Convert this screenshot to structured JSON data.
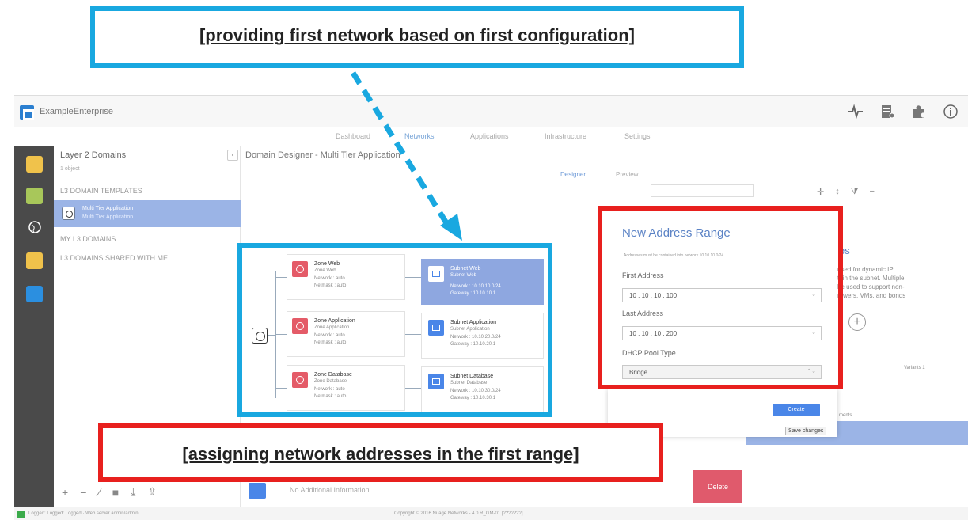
{
  "annotations": {
    "top_callout": "[providing first network based on first configuration]",
    "bottom_callout": "[assigning network addresses in the first range]"
  },
  "app": {
    "title": "ExampleEnterprise",
    "nav_tabs": [
      "Dashboard",
      "Networks",
      "Applications",
      "Infrastructure",
      "Settings"
    ],
    "active_tab": "Networks"
  },
  "panel": {
    "heading": "Layer 2 Domains",
    "object_count": "1 object",
    "categories": [
      "L3 DOMAIN TEMPLATES",
      "MY L3 DOMAINS",
      "L3 DOMAINS SHARED WITH ME"
    ],
    "selected_item": {
      "line1": "Multi Tier Application",
      "line2": "Multi Tier Application"
    }
  },
  "designer": {
    "heading": "Domain Designer - Multi Tier Application",
    "designer_link": "Designer",
    "preview_label": "Preview"
  },
  "diagram": {
    "zones": [
      {
        "name": "Zone Web",
        "sub": "Zone Web",
        "network": "Network : auto",
        "netmask": "Netmask : auto"
      },
      {
        "name": "Zone Application",
        "sub": "Zone Application",
        "network": "Network : auto",
        "netmask": "Netmask : auto"
      },
      {
        "name": "Zone Database",
        "sub": "Zone Database",
        "network": "Network : auto",
        "netmask": "Netmask : auto"
      }
    ],
    "subnets": [
      {
        "name": "Subnet Web",
        "sub": "Subnet Web",
        "network": "Network : 10.10.10.0/24",
        "gateway": "Gateway : 10.10.10.1"
      },
      {
        "name": "Subnet Application",
        "sub": "Subnet Application",
        "network": "Network : 10.10.20.0/24",
        "gateway": "Gateway : 10.10.20.1"
      },
      {
        "name": "Subnet Database",
        "sub": "Subnet Database",
        "network": "Network : 10.10.30.0/24",
        "gateway": "Gateway : 10.10.30.1"
      }
    ]
  },
  "dialog": {
    "title": "New Address Range",
    "note": "Addresses must be contained into network 10.10.10.0/24",
    "first_address_label": "First Address",
    "first_address_value": "10  .  10  .  10  .  100",
    "last_address_label": "Last Address",
    "last_address_value": "10  .  10  .  10  .  200",
    "pool_type_label": "DHCP Pool Type",
    "pool_type_value": "Bridge",
    "create_label": "Create",
    "tooltip": "Save changes"
  },
  "right_panel": {
    "heading": "es",
    "text_lines": [
      "used for dynamic IP",
      "thin the subnet. Multiple",
      "be used to support non-",
      "rewers, VMs, and bonds"
    ],
    "variants": "Variants 1",
    "strip_text": "ments"
  },
  "bottom": {
    "info_text": "No Additional Information",
    "delete_label": "Delete"
  },
  "statusbar": {
    "left": "Logged: Logged: Logged  ·  Web server admin/admin",
    "mid": "Copyright © 2016 Nuage Networks - 4.0.R_GM-01 [???????]"
  },
  "colors": {
    "callout_blue": "#19a8e0",
    "callout_red": "#e8201e",
    "accent": "#4a86e8",
    "delete": "#e05a6c"
  }
}
